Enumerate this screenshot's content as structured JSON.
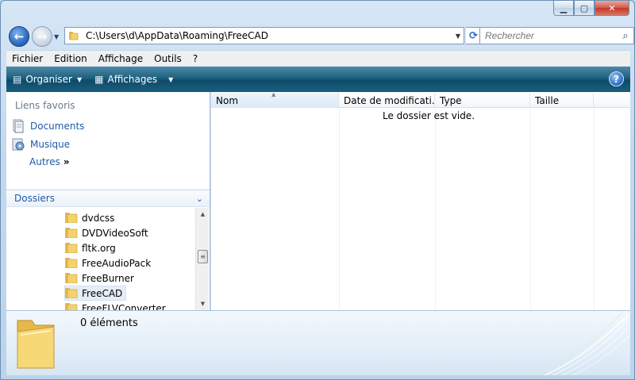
{
  "window": {
    "caption_buttons": {
      "minimize": "minimize-icon",
      "maximize": "maximize-icon",
      "close": "close-icon"
    }
  },
  "navigation": {
    "address_path": "C:\\Users\\d\\AppData\\Roaming\\FreeCAD",
    "search_placeholder": "Rechercher"
  },
  "menu": {
    "items": [
      "Fichier",
      "Edition",
      "Affichage",
      "Outils",
      "?"
    ]
  },
  "toolbar": {
    "organize_label": "Organiser",
    "views_label": "Affichages",
    "help_label": "?"
  },
  "favorites": {
    "title": "Liens favoris",
    "items": [
      {
        "label": "Documents",
        "icon": "documents-icon"
      },
      {
        "label": "Musique",
        "icon": "music-icon"
      }
    ],
    "more_label": "Autres",
    "more_glyph": "»"
  },
  "folders": {
    "title": "Dossiers",
    "items": [
      "dvdcss",
      "DVDVideoSoft",
      "fltk.org",
      "FreeAudioPack",
      "FreeBurner",
      "FreeCAD",
      "FreeFLVConverter"
    ],
    "selected": "FreeCAD"
  },
  "file_list": {
    "columns": [
      "Nom",
      "Date de modificati...",
      "Type",
      "Taille"
    ],
    "sorted_column": "Nom",
    "empty_message": "Le dossier est vide."
  },
  "details": {
    "item_count": "0 éléments"
  },
  "colors": {
    "link_blue": "#1e5aa8",
    "toolbar_dark": "#0d4b6a",
    "folder_yellow": "#f3d36b"
  }
}
